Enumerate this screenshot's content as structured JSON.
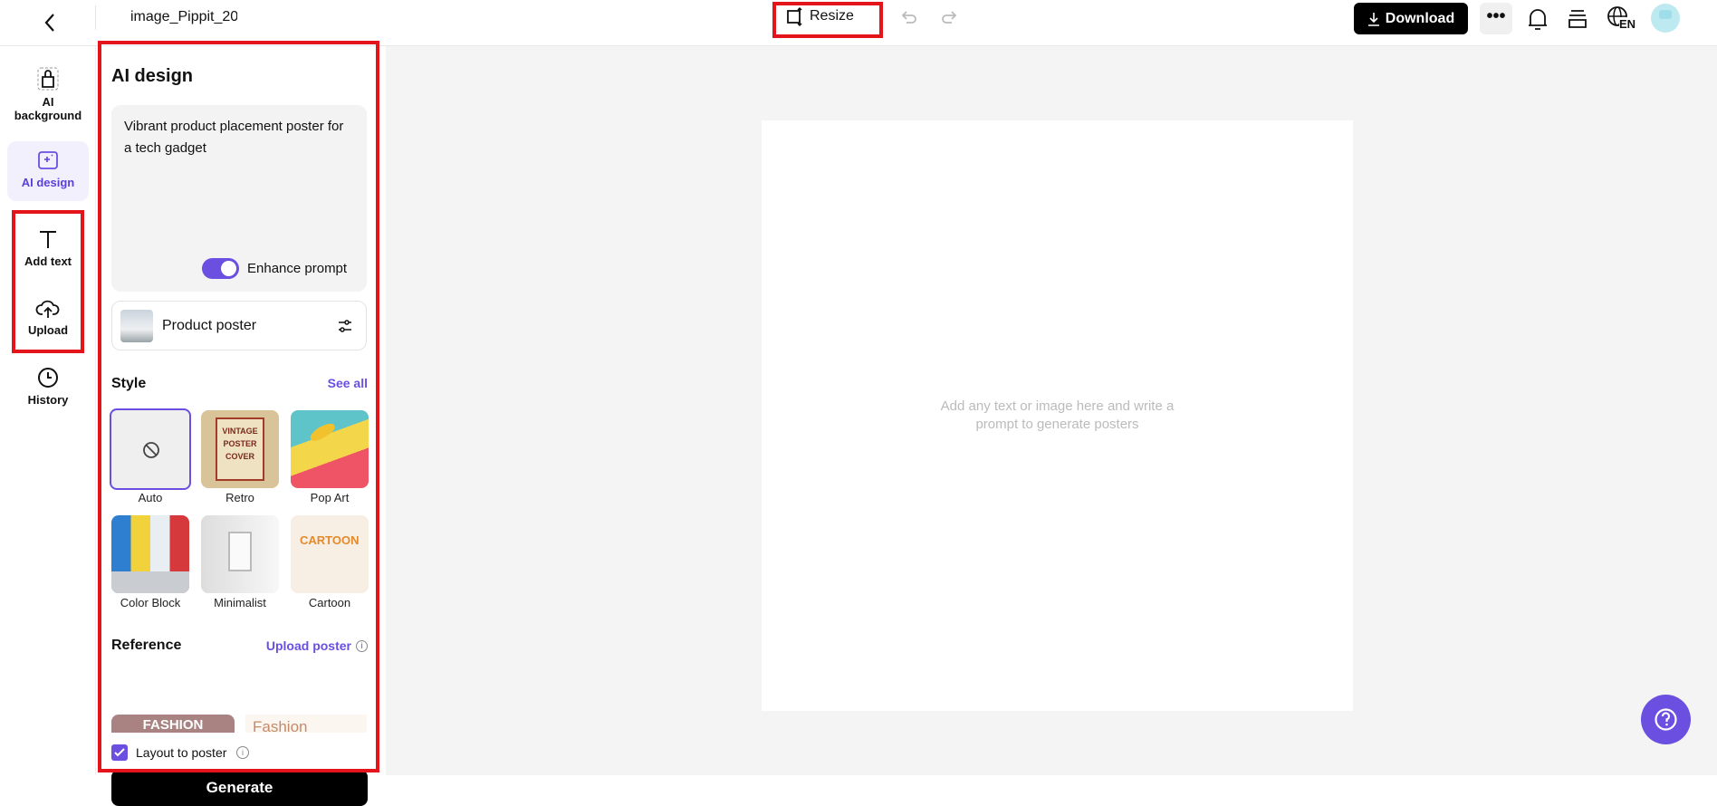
{
  "topbar": {
    "filename": "image_Pippit_20",
    "resize_label": "Resize",
    "download_label": "Download",
    "lang": "EN"
  },
  "rail": {
    "items": [
      {
        "label": "AI background"
      },
      {
        "label": "AI design"
      },
      {
        "label": "Add text"
      },
      {
        "label": "Upload"
      },
      {
        "label": "History"
      }
    ]
  },
  "panel": {
    "title": "AI design",
    "prompt": "Vibrant product placement poster for a tech gadget",
    "enhance_label": "Enhance prompt",
    "enhance_on": true,
    "template_label": "Product poster",
    "style_heading": "Style",
    "see_all": "See all",
    "styles": [
      {
        "label": "Auto"
      },
      {
        "label": "Retro"
      },
      {
        "label": "Pop Art"
      },
      {
        "label": "Color Block"
      },
      {
        "label": "Minimalist"
      },
      {
        "label": "Cartoon"
      }
    ],
    "retro_text": "VINTAGE POSTER COVER",
    "cartoon_text": "CARTOON",
    "reference_heading": "Reference",
    "upload_poster": "Upload poster",
    "ref_images": [
      {
        "text": "FASHION"
      },
      {
        "text": "Fashion"
      }
    ],
    "layout_label": "Layout to poster",
    "layout_checked": true,
    "generate_label": "Generate"
  },
  "canvas": {
    "placeholder": "Add any text or image here and write a prompt to generate posters"
  },
  "colors": {
    "accent": "#6a4fe0",
    "highlight": "#e4141b"
  }
}
